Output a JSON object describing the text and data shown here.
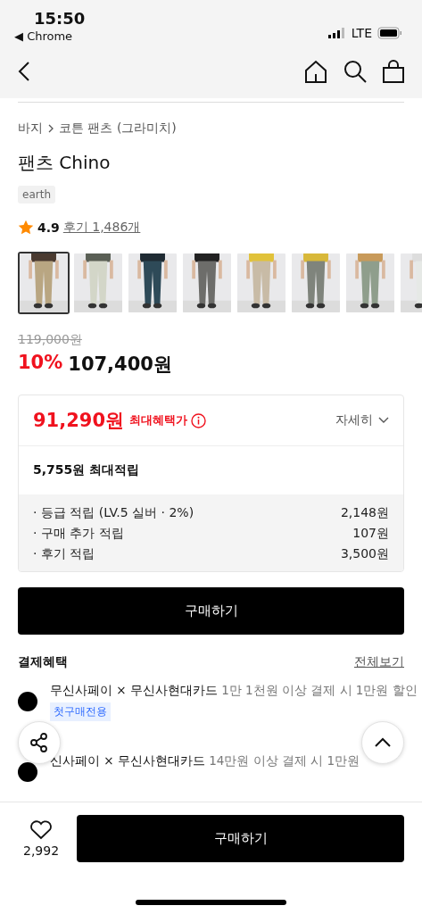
{
  "status_bar": {
    "time": "15:50",
    "back_app": "◀ Chrome",
    "network": "LTE"
  },
  "breadcrumb": [
    "바지",
    "코튼 팬츠 (그라미치)"
  ],
  "product": {
    "title": "팬츠 Chino",
    "tag": "earth",
    "rating": "4.9",
    "reviews": "후기 1,486개"
  },
  "thumbnails": [
    {
      "kind": "picture",
      "selected": true
    },
    {
      "kind": "picture",
      "selected": false
    },
    {
      "kind": "picture",
      "selected": false
    },
    {
      "kind": "picture",
      "selected": false
    },
    {
      "kind": "picture",
      "selected": false
    },
    {
      "kind": "picture",
      "selected": false
    },
    {
      "kind": "picture",
      "selected": false
    },
    {
      "kind": "picture",
      "selected": false
    }
  ],
  "price": {
    "original": "119,000원",
    "discount": "10%",
    "current": "107,400원"
  },
  "benefits": {
    "max_price": "91,290원",
    "max_label": "최대혜택가",
    "details": "자세히",
    "points_total": "5,755원 최대적립",
    "points": [
      {
        "label": "· 등급 적립 (LV.5 실버 · 2%)",
        "value": "2,148원"
      },
      {
        "label": "· 구매 추가 적립",
        "value": "107원"
      },
      {
        "label": "· 후기 적립",
        "value": "3,500원"
      }
    ]
  },
  "buy_button": "구매하기",
  "payment": {
    "title": "결제혜택",
    "view_all": "전체보기",
    "rows": [
      {
        "brand": "무신사페이 × 무신사현대카드",
        "text": "1만 1천원 이상 결제 시 1만원 할인",
        "badge": "첫구매전용"
      },
      {
        "brand": "신사페이 × 무신사현대카드",
        "text": "14만원 이상 결제 시 1만원"
      }
    ]
  },
  "bottom_bar": {
    "likes": "2,992",
    "buy": "구매하기"
  }
}
